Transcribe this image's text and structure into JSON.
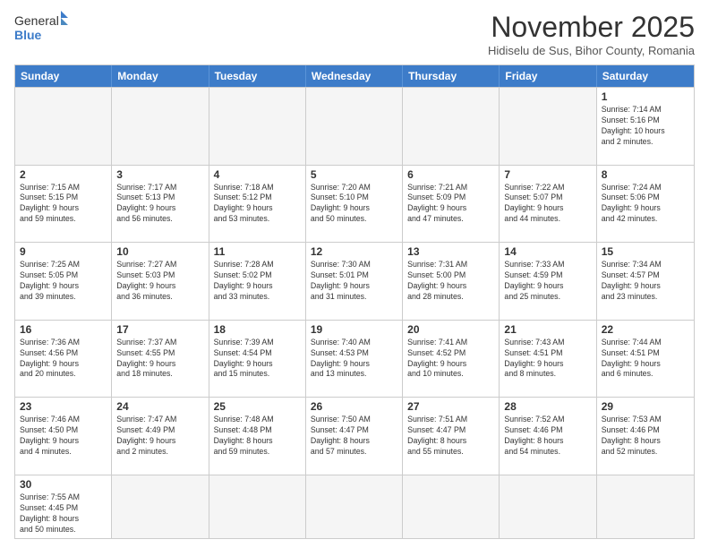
{
  "header": {
    "logo_general": "General",
    "logo_blue": "Blue",
    "month_title": "November 2025",
    "subtitle": "Hidiselu de Sus, Bihor County, Romania"
  },
  "days_of_week": [
    "Sunday",
    "Monday",
    "Tuesday",
    "Wednesday",
    "Thursday",
    "Friday",
    "Saturday"
  ],
  "weeks": [
    [
      {
        "day": "",
        "empty": true
      },
      {
        "day": "",
        "empty": true
      },
      {
        "day": "",
        "empty": true
      },
      {
        "day": "",
        "empty": true
      },
      {
        "day": "",
        "empty": true
      },
      {
        "day": "",
        "empty": true
      },
      {
        "day": "1",
        "info": "Sunrise: 7:14 AM\nSunset: 5:16 PM\nDaylight: 10 hours\nand 2 minutes."
      }
    ],
    [
      {
        "day": "2",
        "info": "Sunrise: 7:15 AM\nSunset: 5:15 PM\nDaylight: 9 hours\nand 59 minutes."
      },
      {
        "day": "3",
        "info": "Sunrise: 7:17 AM\nSunset: 5:13 PM\nDaylight: 9 hours\nand 56 minutes."
      },
      {
        "day": "4",
        "info": "Sunrise: 7:18 AM\nSunset: 5:12 PM\nDaylight: 9 hours\nand 53 minutes."
      },
      {
        "day": "5",
        "info": "Sunrise: 7:20 AM\nSunset: 5:10 PM\nDaylight: 9 hours\nand 50 minutes."
      },
      {
        "day": "6",
        "info": "Sunrise: 7:21 AM\nSunset: 5:09 PM\nDaylight: 9 hours\nand 47 minutes."
      },
      {
        "day": "7",
        "info": "Sunrise: 7:22 AM\nSunset: 5:07 PM\nDaylight: 9 hours\nand 44 minutes."
      },
      {
        "day": "8",
        "info": "Sunrise: 7:24 AM\nSunset: 5:06 PM\nDaylight: 9 hours\nand 42 minutes."
      }
    ],
    [
      {
        "day": "9",
        "info": "Sunrise: 7:25 AM\nSunset: 5:05 PM\nDaylight: 9 hours\nand 39 minutes."
      },
      {
        "day": "10",
        "info": "Sunrise: 7:27 AM\nSunset: 5:03 PM\nDaylight: 9 hours\nand 36 minutes."
      },
      {
        "day": "11",
        "info": "Sunrise: 7:28 AM\nSunset: 5:02 PM\nDaylight: 9 hours\nand 33 minutes."
      },
      {
        "day": "12",
        "info": "Sunrise: 7:30 AM\nSunset: 5:01 PM\nDaylight: 9 hours\nand 31 minutes."
      },
      {
        "day": "13",
        "info": "Sunrise: 7:31 AM\nSunset: 5:00 PM\nDaylight: 9 hours\nand 28 minutes."
      },
      {
        "day": "14",
        "info": "Sunrise: 7:33 AM\nSunset: 4:59 PM\nDaylight: 9 hours\nand 25 minutes."
      },
      {
        "day": "15",
        "info": "Sunrise: 7:34 AM\nSunset: 4:57 PM\nDaylight: 9 hours\nand 23 minutes."
      }
    ],
    [
      {
        "day": "16",
        "info": "Sunrise: 7:36 AM\nSunset: 4:56 PM\nDaylight: 9 hours\nand 20 minutes."
      },
      {
        "day": "17",
        "info": "Sunrise: 7:37 AM\nSunset: 4:55 PM\nDaylight: 9 hours\nand 18 minutes."
      },
      {
        "day": "18",
        "info": "Sunrise: 7:39 AM\nSunset: 4:54 PM\nDaylight: 9 hours\nand 15 minutes."
      },
      {
        "day": "19",
        "info": "Sunrise: 7:40 AM\nSunset: 4:53 PM\nDaylight: 9 hours\nand 13 minutes."
      },
      {
        "day": "20",
        "info": "Sunrise: 7:41 AM\nSunset: 4:52 PM\nDaylight: 9 hours\nand 10 minutes."
      },
      {
        "day": "21",
        "info": "Sunrise: 7:43 AM\nSunset: 4:51 PM\nDaylight: 9 hours\nand 8 minutes."
      },
      {
        "day": "22",
        "info": "Sunrise: 7:44 AM\nSunset: 4:51 PM\nDaylight: 9 hours\nand 6 minutes."
      }
    ],
    [
      {
        "day": "23",
        "info": "Sunrise: 7:46 AM\nSunset: 4:50 PM\nDaylight: 9 hours\nand 4 minutes."
      },
      {
        "day": "24",
        "info": "Sunrise: 7:47 AM\nSunset: 4:49 PM\nDaylight: 9 hours\nand 2 minutes."
      },
      {
        "day": "25",
        "info": "Sunrise: 7:48 AM\nSunset: 4:48 PM\nDaylight: 8 hours\nand 59 minutes."
      },
      {
        "day": "26",
        "info": "Sunrise: 7:50 AM\nSunset: 4:47 PM\nDaylight: 8 hours\nand 57 minutes."
      },
      {
        "day": "27",
        "info": "Sunrise: 7:51 AM\nSunset: 4:47 PM\nDaylight: 8 hours\nand 55 minutes."
      },
      {
        "day": "28",
        "info": "Sunrise: 7:52 AM\nSunset: 4:46 PM\nDaylight: 8 hours\nand 54 minutes."
      },
      {
        "day": "29",
        "info": "Sunrise: 7:53 AM\nSunset: 4:46 PM\nDaylight: 8 hours\nand 52 minutes."
      }
    ],
    [
      {
        "day": "30",
        "info": "Sunrise: 7:55 AM\nSunset: 4:45 PM\nDaylight: 8 hours\nand 50 minutes."
      },
      {
        "day": "",
        "empty": true
      },
      {
        "day": "",
        "empty": true
      },
      {
        "day": "",
        "empty": true
      },
      {
        "day": "",
        "empty": true
      },
      {
        "day": "",
        "empty": true
      },
      {
        "day": "",
        "empty": true
      }
    ]
  ]
}
